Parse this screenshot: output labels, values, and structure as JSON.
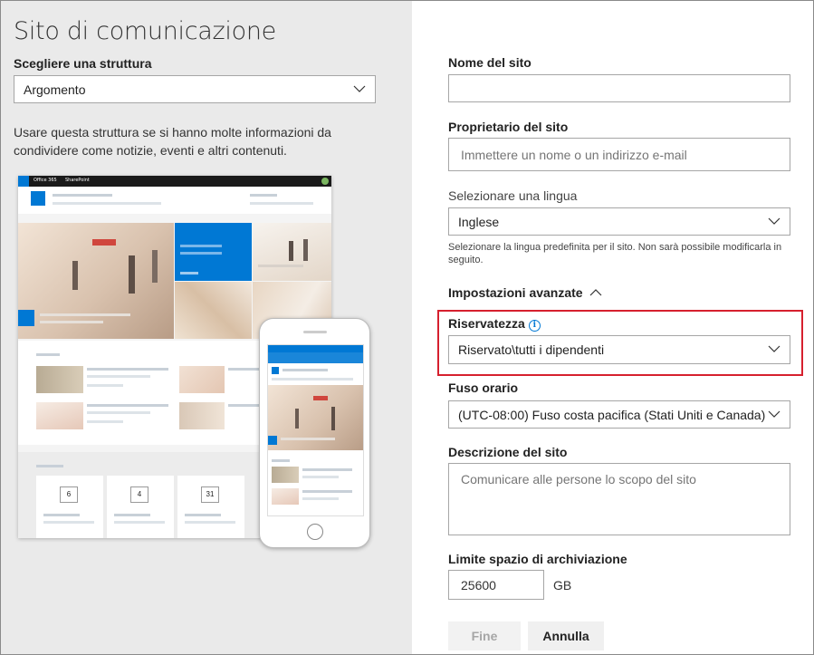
{
  "left": {
    "title": "Sito di comunicazione",
    "structure_label": "Scegliere una struttura",
    "structure_value": "Argomento",
    "description": "Usare questa struttura se si hanno molte informazioni da condividere come notizie, eventi e altri contenuti.",
    "preview": {
      "topbar_app": "Office 365",
      "topbar_product": "SharePoint",
      "event_days": [
        "6",
        "4",
        "31"
      ]
    }
  },
  "form": {
    "site_name_label": "Nome del sito",
    "site_name_value": "",
    "owner_label": "Proprietario del sito",
    "owner_placeholder": "Immettere un nome o un indirizzo e-mail",
    "language_label": "Selezionare una lingua",
    "language_value": "Inglese",
    "language_help": "Selezionare la lingua predefinita per il sito. Non sarà possibile modificarla in seguito.",
    "advanced_label": "Impostazioni avanzate",
    "privacy_label": "Riservatezza",
    "privacy_value": "Riservato\\tutti i dipendenti",
    "timezone_label": "Fuso orario",
    "timezone_value": "(UTC-08:00) Fuso costa pacifica (Stati Uniti e Canada)",
    "desc_label": "Descrizione del sito",
    "desc_placeholder": "Comunicare alle persone lo scopo del sito",
    "storage_label": "Limite spazio di archiviazione",
    "storage_value": "25600",
    "storage_unit": "GB",
    "finish_label": "Fine",
    "cancel_label": "Annulla"
  },
  "colors": {
    "accent": "#0078d4",
    "highlight": "#d6202e",
    "left_panel": "#eaeaea"
  }
}
